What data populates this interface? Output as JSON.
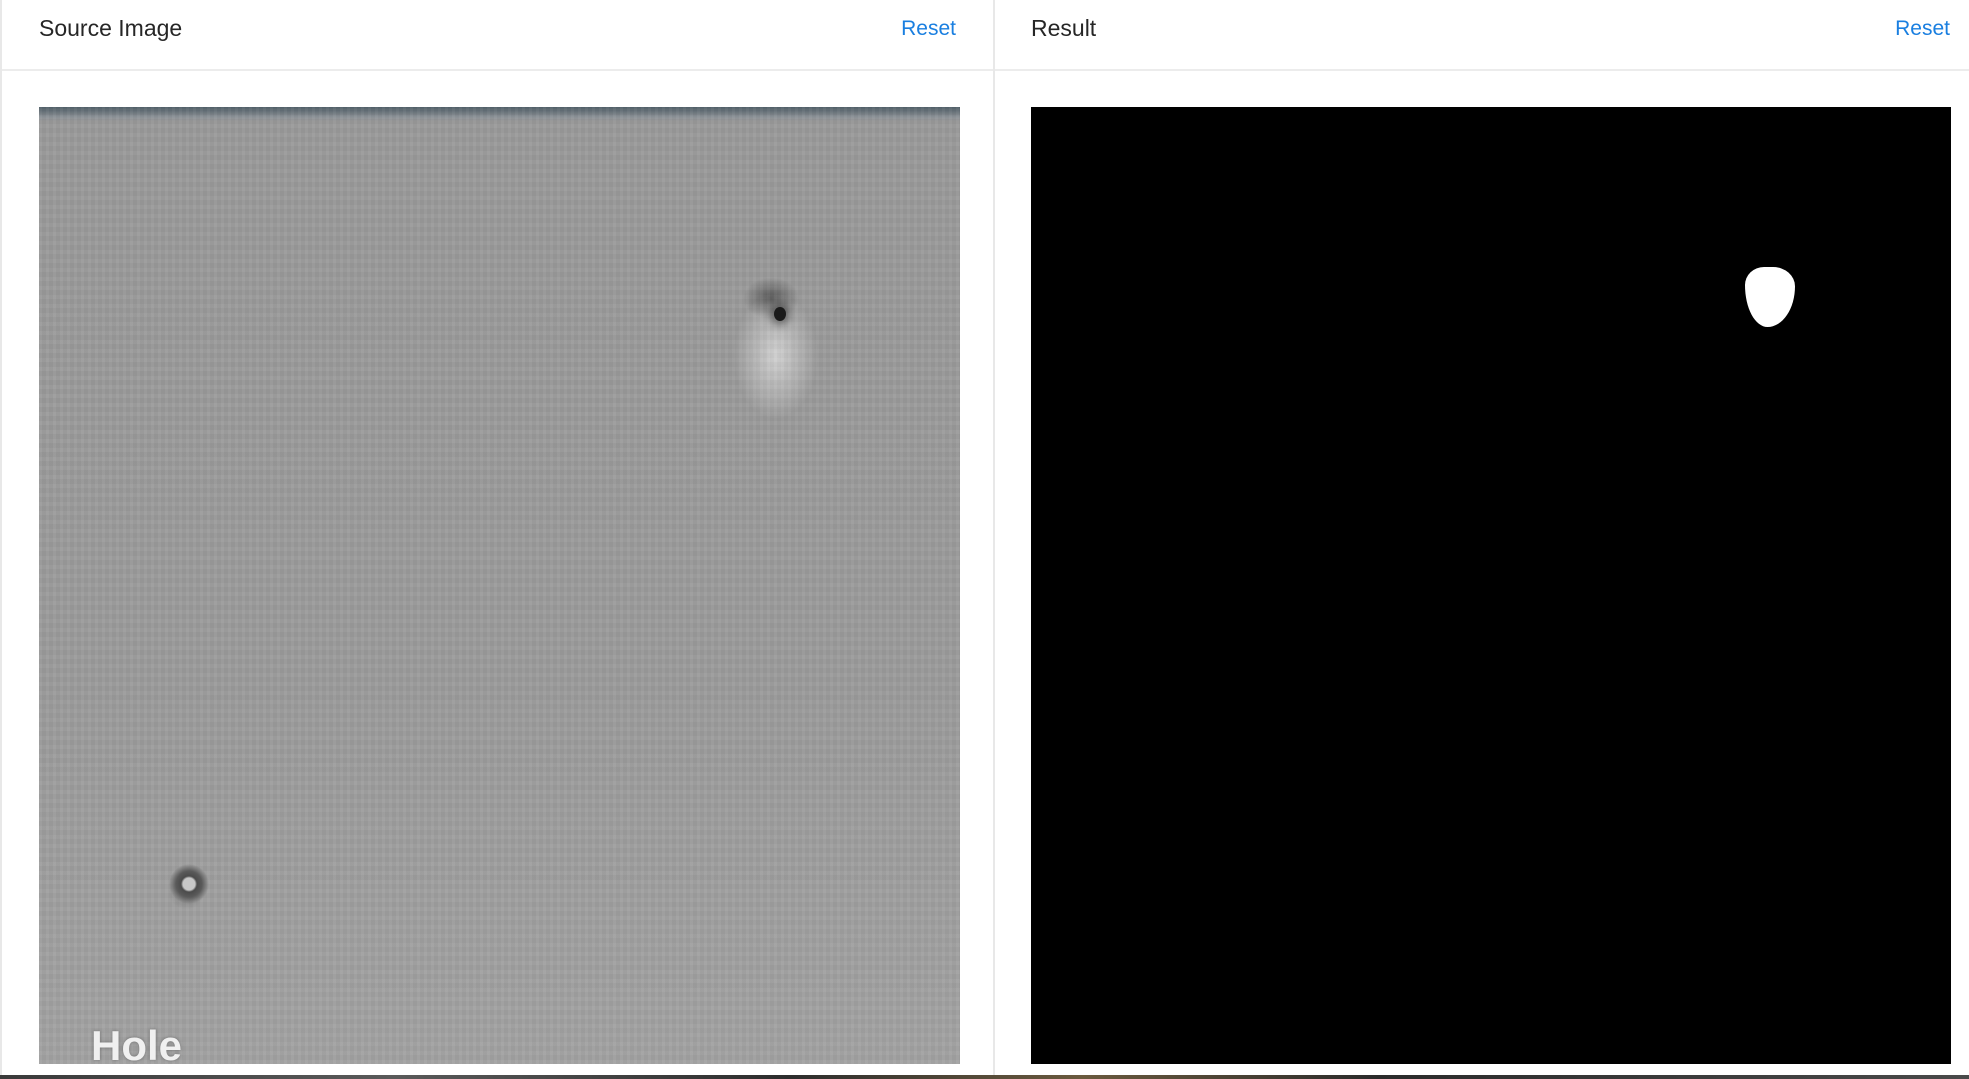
{
  "source_panel": {
    "title": "Source Image",
    "reset_label": "Reset",
    "image_label": "Hole"
  },
  "result_panel": {
    "title": "Result",
    "reset_label": "Reset"
  },
  "colors": {
    "link": "#1a7fe0",
    "title": "#262626",
    "mask_background": "#000000",
    "mask_foreground": "#ffffff"
  }
}
